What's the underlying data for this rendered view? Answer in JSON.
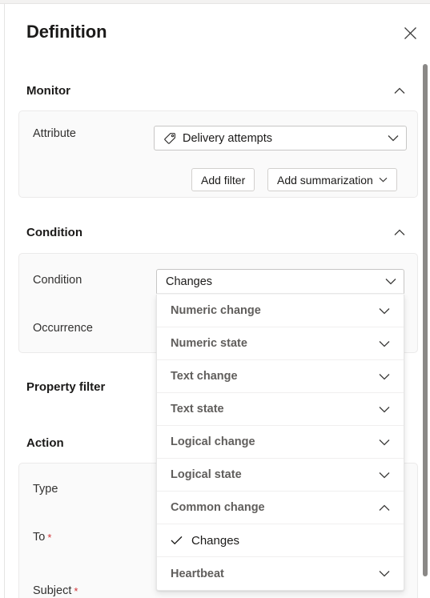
{
  "panel": {
    "title": "Definition",
    "close_icon": "close-icon"
  },
  "sections": {
    "monitor": {
      "label": "Monitor",
      "chevron": "chevron-up-icon",
      "attribute": {
        "label": "Attribute",
        "value": "Delivery attempts",
        "icon": "tag-icon",
        "chevron": "chevron-down-icon"
      },
      "buttons": {
        "add_filter": "Add filter",
        "add_summarization": "Add summarization",
        "add_summarization_chevron": "chevron-down-icon"
      }
    },
    "condition": {
      "label": "Condition",
      "chevron": "chevron-up-icon",
      "condition_field": {
        "label": "Condition",
        "value": "Changes",
        "chevron": "chevron-down-icon"
      },
      "occurrence_field": {
        "label": "Occurrence"
      }
    },
    "property_filter": {
      "label": "Property filter"
    },
    "action": {
      "label": "Action",
      "fields": [
        {
          "label": "Type",
          "required": false
        },
        {
          "label": "To",
          "required": true
        },
        {
          "label": "Subject",
          "required": true
        }
      ],
      "required_marker": "*"
    }
  },
  "condition_dropdown": {
    "items": [
      {
        "label": "Numeric change",
        "type": "group",
        "expanded": false,
        "chevron": "chevron-down-icon"
      },
      {
        "label": "Numeric state",
        "type": "group",
        "expanded": false,
        "chevron": "chevron-down-icon"
      },
      {
        "label": "Text change",
        "type": "group",
        "expanded": false,
        "chevron": "chevron-down-icon"
      },
      {
        "label": "Text state",
        "type": "group",
        "expanded": false,
        "chevron": "chevron-down-icon"
      },
      {
        "label": "Logical change",
        "type": "group",
        "expanded": false,
        "chevron": "chevron-down-icon"
      },
      {
        "label": "Logical state",
        "type": "group",
        "expanded": false,
        "chevron": "chevron-down-icon"
      },
      {
        "label": "Common change",
        "type": "group",
        "expanded": true,
        "chevron": "chevron-up-icon"
      },
      {
        "label": "Changes",
        "type": "option",
        "selected": true,
        "check_icon": "check-icon"
      },
      {
        "label": "Heartbeat",
        "type": "group",
        "expanded": false,
        "chevron": "chevron-down-icon"
      }
    ]
  },
  "scrollbar": {
    "name": "vertical-scrollbar"
  },
  "colors": {
    "text_primary": "#1b1a19",
    "text_secondary": "#605e5c",
    "required": "#d13438",
    "card_bg": "#fafafa",
    "border": "#e6e6e6"
  }
}
